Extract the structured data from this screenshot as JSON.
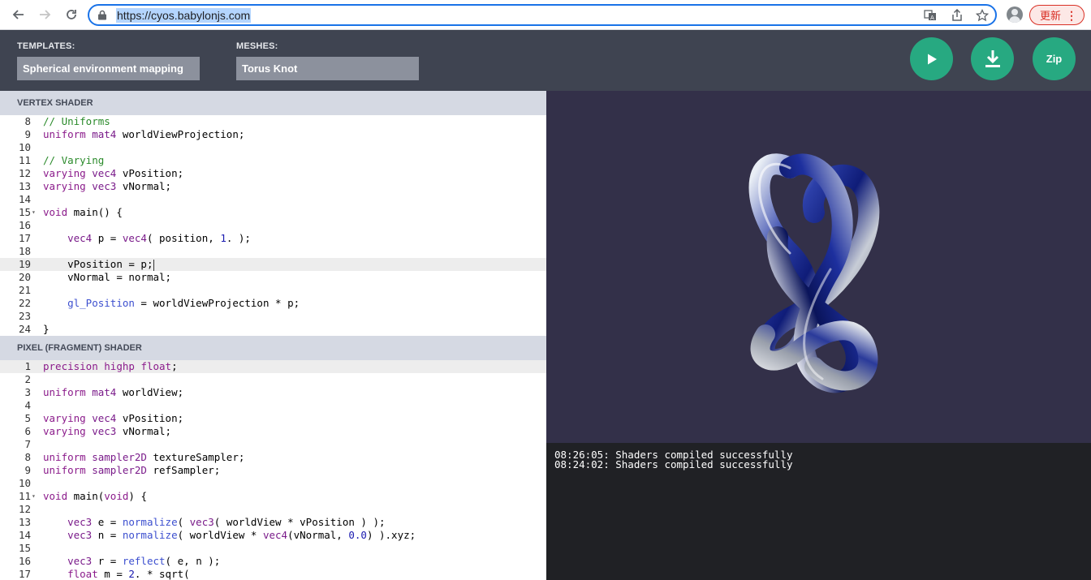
{
  "browser": {
    "url": "https://cyos.babylonjs.com",
    "update_label": "更新"
  },
  "toolbar": {
    "templates_label": "TEMPLATES:",
    "templates_value": "Spherical environment mapping",
    "meshes_label": "MESHES:",
    "meshes_value": "Torus Knot",
    "zip_label": "Zip",
    "accent_color": "#27a981"
  },
  "vertex_shader": {
    "title": "VERTEX SHADER",
    "lines": [
      {
        "n": "8",
        "text": "// Uniforms"
      },
      {
        "n": "9",
        "text": "uniform mat4 worldViewProjection;"
      },
      {
        "n": "10",
        "text": ""
      },
      {
        "n": "11",
        "text": "// Varying"
      },
      {
        "n": "12",
        "text": "varying vec4 vPosition;"
      },
      {
        "n": "13",
        "text": "varying vec3 vNormal;"
      },
      {
        "n": "14",
        "text": ""
      },
      {
        "n": "15",
        "text": "void main() {",
        "fold": true
      },
      {
        "n": "16",
        "text": ""
      },
      {
        "n": "17",
        "text": "    vec4 p = vec4( position, 1. );"
      },
      {
        "n": "18",
        "text": ""
      },
      {
        "n": "19",
        "text": "    vPosition = p;",
        "active": true
      },
      {
        "n": "20",
        "text": "    vNormal = normal;"
      },
      {
        "n": "21",
        "text": ""
      },
      {
        "n": "22",
        "text": "    gl_Position = worldViewProjection * p;"
      },
      {
        "n": "23",
        "text": ""
      },
      {
        "n": "24",
        "text": "}"
      }
    ]
  },
  "pixel_shader": {
    "title": "PIXEL (FRAGMENT) SHADER",
    "lines": [
      {
        "n": "1",
        "text": "precision highp float;",
        "active": true
      },
      {
        "n": "2",
        "text": ""
      },
      {
        "n": "3",
        "text": "uniform mat4 worldView;"
      },
      {
        "n": "4",
        "text": ""
      },
      {
        "n": "5",
        "text": "varying vec4 vPosition;"
      },
      {
        "n": "6",
        "text": "varying vec3 vNormal;"
      },
      {
        "n": "7",
        "text": ""
      },
      {
        "n": "8",
        "text": "uniform sampler2D textureSampler;"
      },
      {
        "n": "9",
        "text": "uniform sampler2D refSampler;"
      },
      {
        "n": "10",
        "text": ""
      },
      {
        "n": "11",
        "text": "void main(void) {",
        "fold": true
      },
      {
        "n": "12",
        "text": ""
      },
      {
        "n": "13",
        "text": "    vec3 e = normalize( vec3( worldView * vPosition ) );"
      },
      {
        "n": "14",
        "text": "    vec3 n = normalize( worldView * vec4(vNormal, 0.0) ).xyz;"
      },
      {
        "n": "15",
        "text": ""
      },
      {
        "n": "16",
        "text": "    vec3 r = reflect( e, n );"
      },
      {
        "n": "17",
        "text": "    float m = 2. * sqrt("
      }
    ]
  },
  "console": {
    "lines": [
      "08:26:05: Shaders compiled successfully",
      "08:24:02: Shaders compiled successfully"
    ]
  }
}
